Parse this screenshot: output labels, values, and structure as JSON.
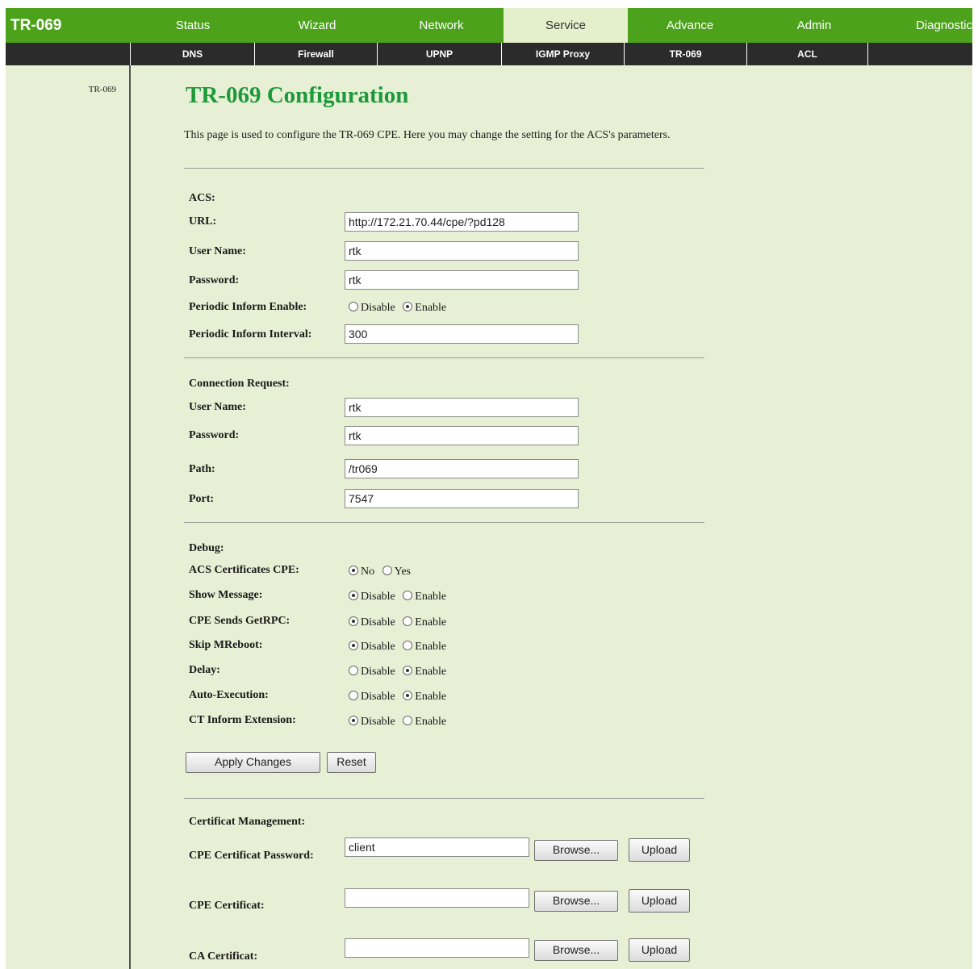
{
  "brand": "TR-069",
  "main_tabs": [
    {
      "label": "Status",
      "active": false
    },
    {
      "label": "Wizard",
      "active": false
    },
    {
      "label": "Network",
      "active": false
    },
    {
      "label": "Service",
      "active": true
    },
    {
      "label": "Advance",
      "active": false
    },
    {
      "label": "Admin",
      "active": false
    },
    {
      "label": "Diagnostic",
      "active": false
    }
  ],
  "sub_tabs": [
    "DNS",
    "Firewall",
    "UPNP",
    "IGMP Proxy",
    "TR-069",
    "ACL"
  ],
  "sidebar": {
    "link": "TR-069"
  },
  "page": {
    "title": "TR-069 Configuration",
    "description": "This page is used to configure the TR-069 CPE. Here you may change the setting for the ACS's parameters."
  },
  "acs": {
    "heading": "ACS:",
    "url_label": "URL:",
    "url_value": "http://172.21.70.44/cpe/?pd128",
    "username_label": "User Name:",
    "username_value": "rtk",
    "password_label": "Password:",
    "password_value": "rtk",
    "periodic_enable_label": "Periodic Inform Enable:",
    "periodic_disable_opt": "Disable",
    "periodic_enable_opt": "Enable",
    "periodic_selected": "Enable",
    "interval_label": "Periodic Inform Interval:",
    "interval_value": "300"
  },
  "connection": {
    "heading": "Connection Request:",
    "username_label": "User Name:",
    "username_value": "rtk",
    "password_label": "Password:",
    "password_value": "rtk",
    "path_label": "Path:",
    "path_value": "/tr069",
    "port_label": "Port:",
    "port_value": "7547"
  },
  "debug": {
    "heading": "Debug:",
    "acs_cert": {
      "label": "ACS Certificates CPE:",
      "opt1": "No",
      "opt2": "Yes",
      "selected": "No"
    },
    "show_message": {
      "label": "Show Message:",
      "opt1": "Disable",
      "opt2": "Enable",
      "selected": "Disable"
    },
    "cpe_sends": {
      "label": "CPE Sends GetRPC:",
      "opt1": "Disable",
      "opt2": "Enable",
      "selected": "Disable"
    },
    "skip_reboot": {
      "label": "Skip MReboot:",
      "opt1": "Disable",
      "opt2": "Enable",
      "selected": "Disable"
    },
    "delay": {
      "label": "Delay:",
      "opt1": "Disable",
      "opt2": "Enable",
      "selected": "Enable"
    },
    "auto_exec": {
      "label": "Auto-Execution:",
      "opt1": "Disable",
      "opt2": "Enable",
      "selected": "Enable"
    },
    "ct_inform": {
      "label": "CT Inform Extension:",
      "opt1": "Disable",
      "opt2": "Enable",
      "selected": "Disable"
    }
  },
  "buttons": {
    "apply": "Apply Changes",
    "reset": "Reset"
  },
  "cert": {
    "heading": "Certificat Management:",
    "cpe_pwd_label": "CPE Certificat Password:",
    "cpe_pwd_value": "client",
    "cpe_cert_label": "CPE Certificat:",
    "ca_cert_label": "CA Certificat:",
    "browse": "Browse...",
    "upload": "Upload"
  }
}
